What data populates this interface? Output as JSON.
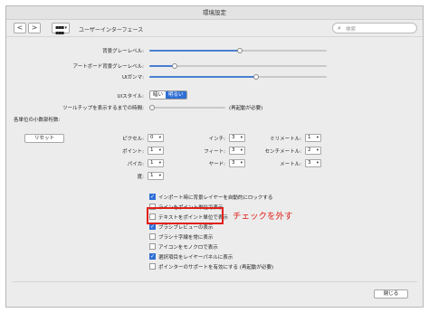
{
  "window": {
    "title": "環境設定"
  },
  "toolbar": {
    "back": "<",
    "forward": ">",
    "breadcrumb": "ユーザーインターフェース",
    "search_placeholder": "検索"
  },
  "sliders": {
    "bg_gray": {
      "label": "背景グレーレベル:",
      "value": 0.72
    },
    "artboard_gray": {
      "label": "アートボード背景グレーレベル:",
      "value": 0.14
    },
    "ui_gamma": {
      "label": "UIガンマ:",
      "value": 0.6
    },
    "tooltip_delay": {
      "label": "ツールチップを表示するまでの時間:",
      "note": "(再起動が必要)",
      "value": 0.02
    }
  },
  "ui_style": {
    "label": "UIスタイル:",
    "dark": "暗い",
    "light": "明るい",
    "selected": "明るい"
  },
  "decimals": {
    "header": "各単位の小数部桁数:",
    "reset": "リセット",
    "fields": [
      {
        "label": "ピクセル:",
        "value": "0"
      },
      {
        "label": "ポイント:",
        "value": "1"
      },
      {
        "label": "パイカ:",
        "value": "1"
      },
      {
        "label": "度:",
        "value": "1"
      },
      {
        "label": "インチ:",
        "value": "3"
      },
      {
        "label": "フィート:",
        "value": "3"
      },
      {
        "label": "ヤード:",
        "value": "3"
      },
      {
        "label": "ミリメートル:",
        "value": "1"
      },
      {
        "label": "センチメートル:",
        "value": "2"
      },
      {
        "label": "メートル:",
        "value": "3"
      }
    ]
  },
  "options": [
    {
      "label": "インポート時に背景レイヤーを自動的にロックする",
      "checked": true
    },
    {
      "label": "ラインをポイント単位で表示",
      "checked": false
    },
    {
      "label": "テキストをポイント単位で表示",
      "checked": false
    },
    {
      "label": "ブラシプレビューの表示",
      "checked": true
    },
    {
      "label": "ブラシ十字線を常に表示",
      "checked": false
    },
    {
      "label": "アイコンをモノクロで表示",
      "checked": false
    },
    {
      "label": "選択項目をレイヤーパネルに表示",
      "checked": true
    },
    {
      "label": "ポインターのサポートを有効にする (再起動が必要)",
      "checked": false
    }
  ],
  "annotation": "チェックを外す",
  "footer": {
    "close": "閉じる"
  },
  "colors": {
    "accent": "#2f6fd6",
    "annotation": "#e0201a"
  }
}
